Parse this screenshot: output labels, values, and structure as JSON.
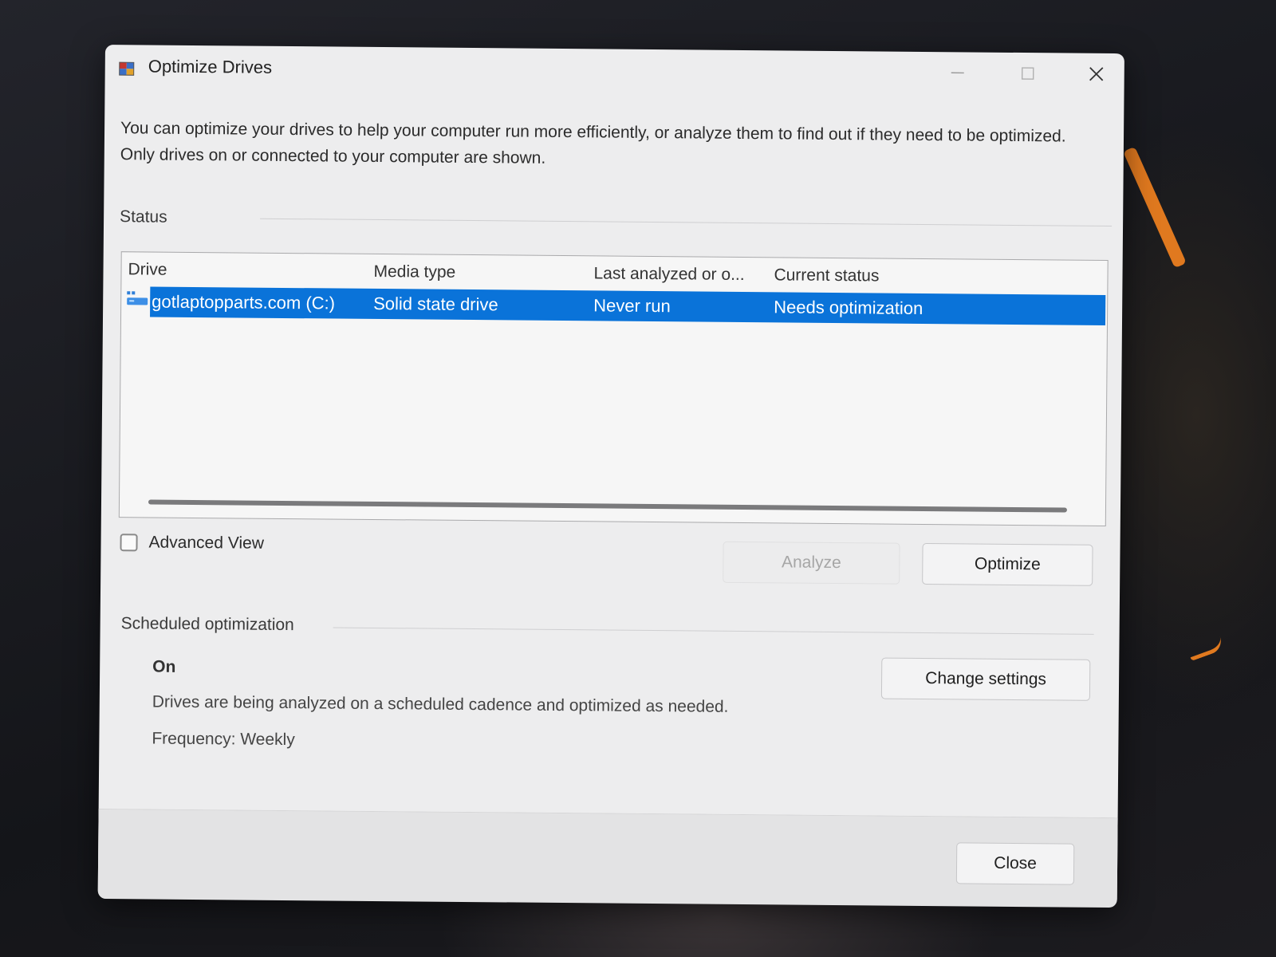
{
  "window": {
    "title": "Optimize Drives",
    "minimize_glyph": "—",
    "maximize_glyph": "☐",
    "close_glyph": "✕"
  },
  "description": "You can optimize your drives to help your computer run more efficiently, or analyze them to find out if they need to be optimized. Only drives on or connected to your computer are shown.",
  "status": {
    "label": "Status",
    "columns": [
      "Drive",
      "Media type",
      "Last analyzed or o...",
      "Current status"
    ],
    "rows": [
      {
        "drive": "gotlaptopparts.com (C:)",
        "media_type": "Solid state drive",
        "last_analyzed": "Never run",
        "current_status": "Needs optimization",
        "selected": true
      }
    ]
  },
  "advanced_view": {
    "label": "Advanced View",
    "checked": false
  },
  "buttons": {
    "analyze": "Analyze",
    "optimize": "Optimize",
    "change_settings": "Change settings",
    "close": "Close"
  },
  "scheduled": {
    "label": "Scheduled optimization",
    "state": "On",
    "description": "Drives are being analyzed on a scheduled cadence and optimized as needed.",
    "frequency": "Frequency: Weekly"
  },
  "colors": {
    "selection": "#0a73d9",
    "dialog_bg": "#ededee",
    "accent_orange": "#e0791f"
  },
  "icons": {
    "app": "defrag-icon",
    "drive": "drive-icon",
    "minimize": "minimize-icon",
    "maximize": "maximize-icon",
    "close": "close-icon"
  }
}
